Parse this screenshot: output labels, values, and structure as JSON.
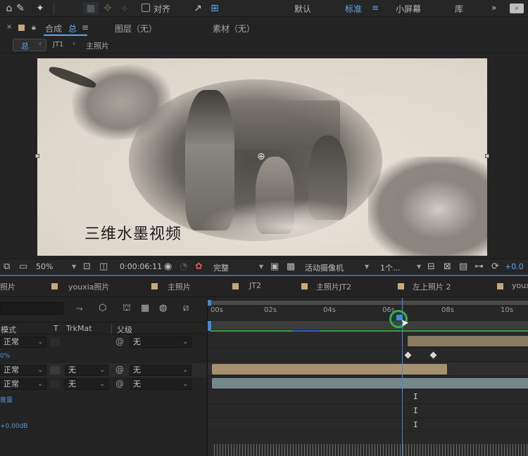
{
  "toolbar": {
    "snap_label": "对齐",
    "workspaces": [
      "默认",
      "标准",
      "小屏幕",
      "库"
    ],
    "active_workspace": "标准",
    "more": "»"
  },
  "panel": {
    "comp_prefix": "合成",
    "comp_name": "总",
    "layer_tab": "图层（无）",
    "footage_tab": "素材（无）"
  },
  "breadcrumb": {
    "items": [
      "总",
      "JT1",
      "主照片"
    ]
  },
  "composition": {
    "title_text": "三维水墨视频"
  },
  "viewer_bar": {
    "zoom": "50%",
    "timecode": "0:00:06:11",
    "resolution": "完整",
    "camera": "活动摄像机",
    "views": "1个...",
    "exposure": "+0.0"
  },
  "timeline_tabs": [
    "照片",
    "youxia照片",
    "主照片",
    "JT2",
    "主照片JT2",
    "左上照片 2",
    "youx"
  ],
  "layer_columns": {
    "mode": "模式",
    "t": "T",
    "trkmat": "TrkMat",
    "parent": "父级"
  },
  "layer_rows": [
    {
      "mode": "正常",
      "trkmat": "",
      "parent": "无"
    },
    {
      "prop": "0%"
    },
    {
      "mode": "正常",
      "trkmat": "无",
      "parent": "无"
    },
    {
      "mode": "正常",
      "trkmat": "无",
      "parent": "无"
    },
    {
      "prop": "度量"
    },
    {
      "prop": ""
    },
    {
      "prop": "+0.00dB"
    }
  ],
  "ruler": {
    "ticks": [
      "00s",
      "02s",
      "04s",
      "06s",
      "08s",
      "10s"
    ]
  },
  "colors": {
    "accent": "#3b8be0",
    "layer_bar_tan": "#a6906f",
    "layer_bar_teal": "#74888a",
    "label_tan": "#c8a878"
  }
}
